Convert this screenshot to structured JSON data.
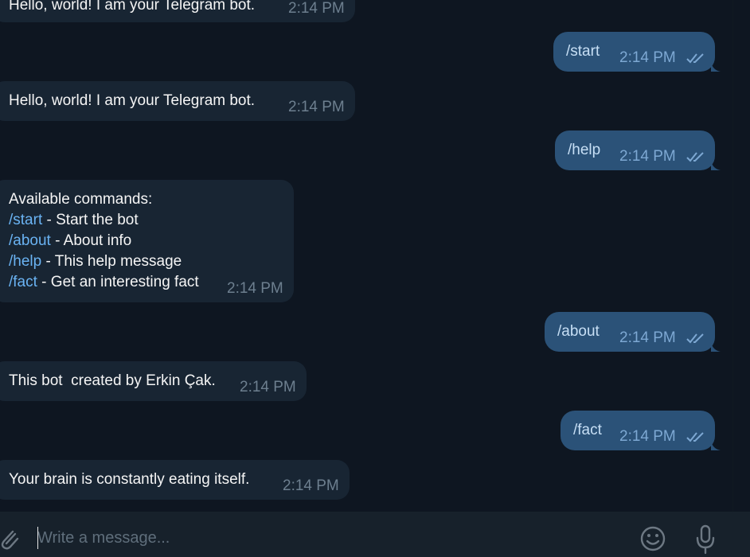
{
  "messages": [
    {
      "id": "m1",
      "direction": "in",
      "text": "Hello, world! I am your Telegram bot.",
      "time": "2:14 PM"
    },
    {
      "id": "m2",
      "direction": "out",
      "text": "/start",
      "time": "2:14 PM",
      "status": "read"
    },
    {
      "id": "m3",
      "direction": "in",
      "text": "Hello, world! I am your Telegram bot.",
      "time": "2:14 PM"
    },
    {
      "id": "m4",
      "direction": "out",
      "text": "/help",
      "time": "2:14 PM",
      "status": "read"
    },
    {
      "id": "m5",
      "direction": "in",
      "time": "2:14 PM",
      "lines": [
        {
          "text": "Available commands:"
        },
        {
          "cmd": "/start",
          "text": " - Start the bot"
        },
        {
          "cmd": "/about",
          "text": " - About info"
        },
        {
          "cmd": "/help",
          "text": " - This help message"
        },
        {
          "cmd": "/fact",
          "text": " - Get an interesting fact"
        }
      ]
    },
    {
      "id": "m6",
      "direction": "out",
      "text": "/about",
      "time": "2:14 PM",
      "status": "read"
    },
    {
      "id": "m7",
      "direction": "in",
      "text": "This bot  created by Erkin Çak.",
      "time": "2:14 PM"
    },
    {
      "id": "m8",
      "direction": "out",
      "text": "/fact",
      "time": "2:14 PM",
      "status": "read"
    },
    {
      "id": "m9",
      "direction": "in",
      "text": "Your brain is constantly eating itself.",
      "time": "2:14 PM"
    }
  ],
  "composer": {
    "placeholder": "Write a message...",
    "value": "",
    "attach_icon": "paperclip-icon",
    "emoji_icon": "smiley-icon",
    "voice_icon": "microphone-icon"
  },
  "colors": {
    "background": "#0e1621",
    "incoming_bubble": "#182533",
    "outgoing_bubble": "#2b5278",
    "link": "#6ab3f3",
    "composer": "#17212b"
  }
}
